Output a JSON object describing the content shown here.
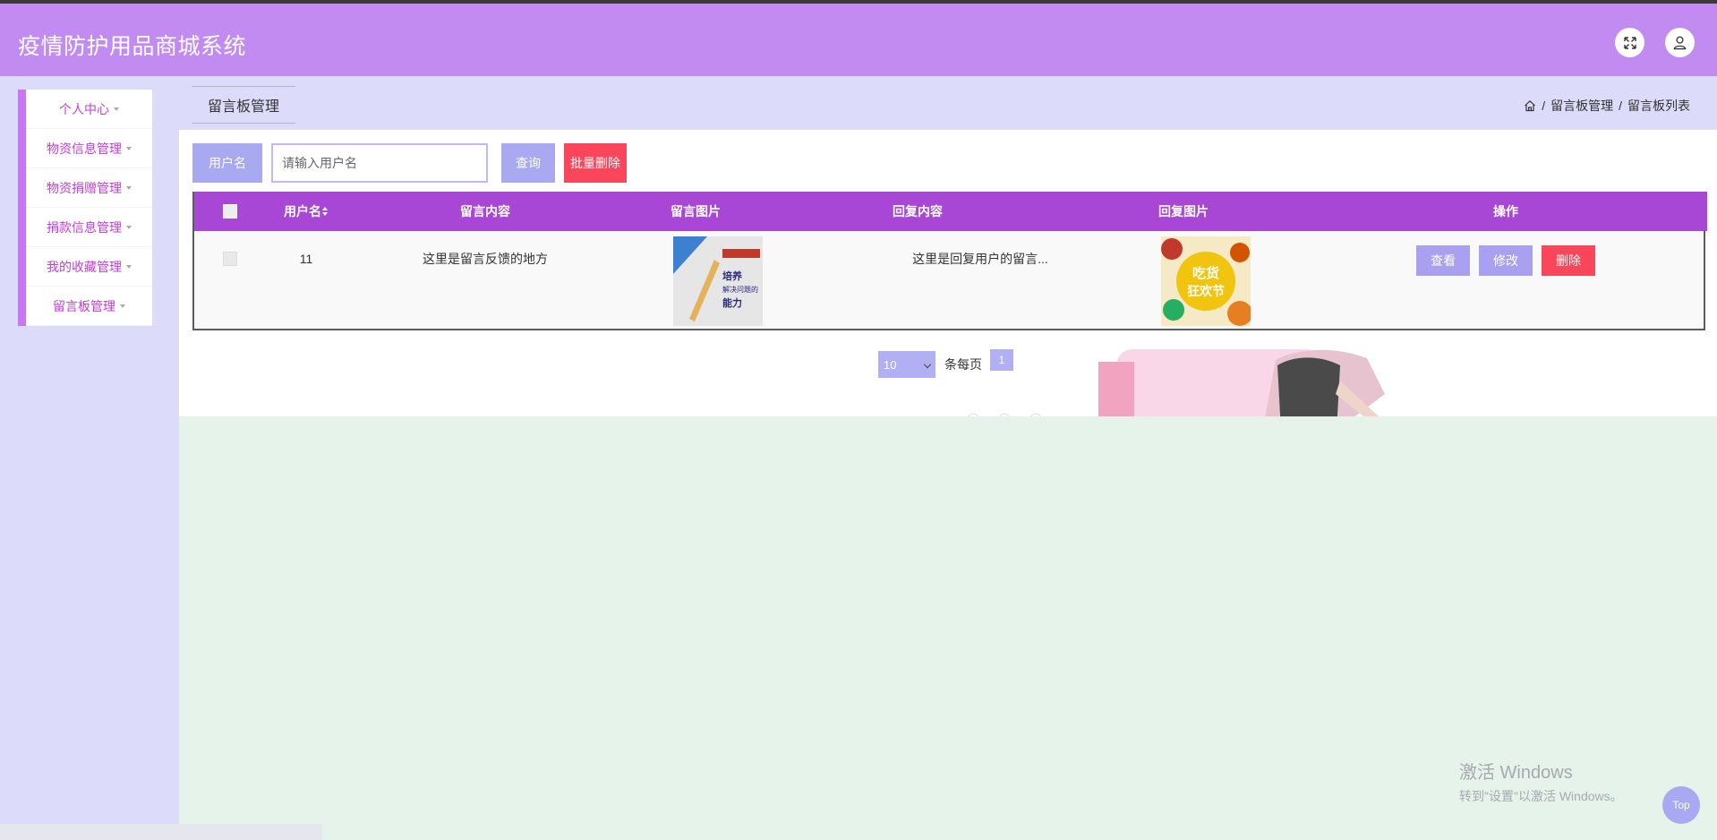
{
  "app": {
    "title": "疫情防护用品商城系统"
  },
  "header": {
    "fullscreen_icon": "expand-icon",
    "user_icon": "user-icon"
  },
  "sidebar": {
    "items": [
      {
        "label": "个人中心"
      },
      {
        "label": "物资信息管理"
      },
      {
        "label": "物资捐赠管理"
      },
      {
        "label": "捐款信息管理"
      },
      {
        "label": "我的收藏管理"
      },
      {
        "label": "留言板管理"
      }
    ]
  },
  "page": {
    "tab_title": "留言板管理",
    "breadcrumb": {
      "home_icon": "home-icon",
      "level1": "留言板管理",
      "level2": "留言板列表",
      "separator": "/"
    }
  },
  "search": {
    "label": "用户名",
    "placeholder": "请输入用户名",
    "value": "",
    "query_button": "查询",
    "batch_delete_button": "批量删除"
  },
  "table": {
    "headers": {
      "username": "用户名",
      "content": "留言内容",
      "image": "留言图片",
      "reply": "回复内容",
      "reply_image": "回复图片",
      "actions": "操作"
    },
    "rows": [
      {
        "username": "11",
        "content": "这里是留言反馈的地方",
        "image_text": [
          "培养",
          "解决问题的",
          "能力"
        ],
        "reply": "这里是回复用户的留言...",
        "reply_image_text": [
          "吃货",
          "狂欢节"
        ],
        "actions": {
          "view": "查看",
          "edit": "修改",
          "delete": "删除"
        }
      }
    ]
  },
  "pagination": {
    "page_size": "10",
    "per_page_label": "条每页",
    "current_page": "1"
  },
  "watermark": {
    "line1": "激活 Windows",
    "line2": "转到\"设置\"以激活 Windows。"
  },
  "back_to_top": "Top",
  "colors": {
    "header": "#c18bf2",
    "accent_purple": "#a846d6",
    "button_lavender": "#a9a9f2",
    "danger": "#f9465b",
    "sidebar_text": "#c53cd8"
  }
}
